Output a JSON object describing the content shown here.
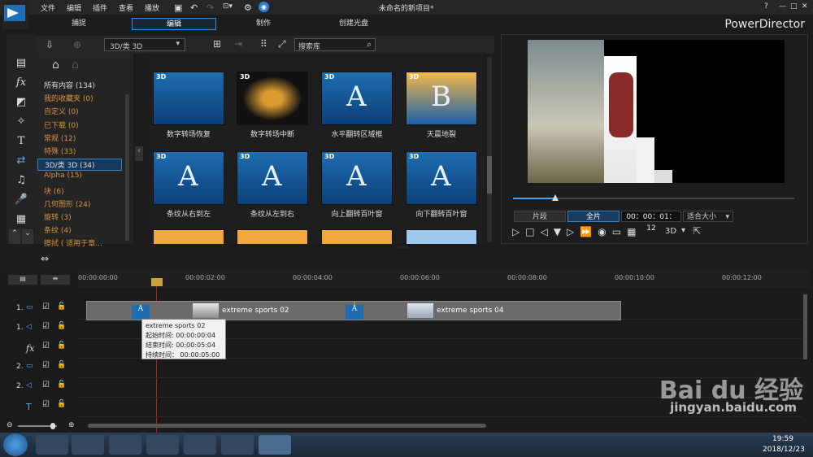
{
  "menu": {
    "items": [
      "文件",
      "编辑",
      "插件",
      "查看",
      "播放"
    ],
    "project_title": "未命名的新项目*"
  },
  "window": {
    "help": "?",
    "minimize": "—",
    "restore": "□",
    "close": "✕"
  },
  "mode_tabs": [
    "捕捉",
    "编辑",
    "制作",
    "创建光盘"
  ],
  "brand": "PowerDirector",
  "library": {
    "filter": "3D/类 3D",
    "search_placeholder": "搜索库",
    "categories": [
      {
        "label": "所有内容 (134)",
        "style": "white"
      },
      {
        "label": "我的收藏夹 (0)",
        "style": "orange"
      },
      {
        "label": "自定义 (0)",
        "style": "orange"
      },
      {
        "label": "已下载 (0)",
        "style": "orange"
      },
      {
        "label": "常规 (12)",
        "style": "orange"
      },
      {
        "label": "特殊 (33)",
        "style": "orange"
      },
      {
        "label": "3D/类 3D (34)",
        "style": "selected"
      },
      {
        "label": "Alpha (15)",
        "style": "orange"
      },
      {
        "label": "块 (6)",
        "style": "orange"
      },
      {
        "label": "几何图形 (24)",
        "style": "orange"
      },
      {
        "label": "旋转 (3)",
        "style": "orange"
      },
      {
        "label": "条纹 (4)",
        "style": "orange"
      },
      {
        "label": "擦拭 ( 适用于章...",
        "style": "orange"
      }
    ],
    "thumbnails": [
      {
        "caption": "数字转场恢复"
      },
      {
        "caption": "数字转场中断"
      },
      {
        "caption": "水平翻转区域框"
      },
      {
        "caption": "天晨地裂"
      },
      {
        "caption": "条纹从右到左"
      },
      {
        "caption": "条纹从左到右"
      },
      {
        "caption": "向上翻转百叶窗"
      },
      {
        "caption": "向下翻转百叶窗"
      }
    ],
    "badge": "3D",
    "letter_a": "A",
    "letter_b": "B"
  },
  "preview": {
    "mode_clip": "片段",
    "mode_full": "全片",
    "timecode": "00：00：01：12",
    "fit": "适合大小",
    "three_d": "3D"
  },
  "timeline": {
    "ruler": [
      "00:00:00:00",
      "00:00:02:00",
      "00:00:04:00",
      "00:00:06:00",
      "00:00:08:00",
      "00:00:10:00",
      "00:00:12:00"
    ],
    "tracks": [
      "1.",
      "1.",
      "fx",
      "2.",
      "2.",
      "T"
    ],
    "clips": [
      {
        "name": "extreme sports 02"
      },
      {
        "name": "extreme sports 04"
      }
    ],
    "tooltip": {
      "title": "extreme sports 02",
      "start": "起始时间: 00:00:00:04",
      "end": "结束时间: 00:00:05:04",
      "duration": "持续时间： 00:00:05:00"
    }
  },
  "taskbar": {
    "time": "19:59",
    "date": "2018/12/23"
  },
  "watermark": {
    "brand": "Bai du 经验",
    "url": "jingyan.baidu.com"
  }
}
